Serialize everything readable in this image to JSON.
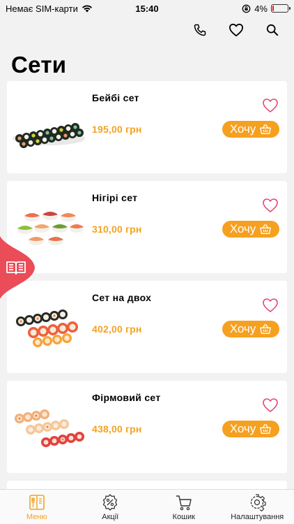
{
  "status_bar": {
    "carrier": "Немає SIM-карти",
    "time": "15:40",
    "battery_percent": "4%",
    "battery_level": 0.04
  },
  "title": "Сети",
  "products": [
    {
      "name": "Бейбі сет",
      "price": "195,00 грн",
      "button": "Хочу"
    },
    {
      "name": "Нігірі сет",
      "price": "310,00 грн",
      "button": "Хочу"
    },
    {
      "name": "Сет на двох",
      "price": "402,00 грн",
      "button": "Хочу"
    },
    {
      "name": "Фірмовий сет",
      "price": "438,00 грн",
      "button": "Хочу"
    }
  ],
  "tabbar": {
    "items": [
      {
        "label": "Меню",
        "icon": "menu-book-icon",
        "active": true
      },
      {
        "label": "Акції",
        "icon": "discount-icon",
        "active": false
      },
      {
        "label": "Кошик",
        "icon": "cart-icon",
        "active": false
      },
      {
        "label": "Налаштування",
        "icon": "settings-gear-icon",
        "active": false
      }
    ]
  },
  "colors": {
    "accent": "#f4a21e",
    "heart": "#e6456f",
    "menu_tab": "#ea4c58",
    "background": "#f2f2f2"
  }
}
